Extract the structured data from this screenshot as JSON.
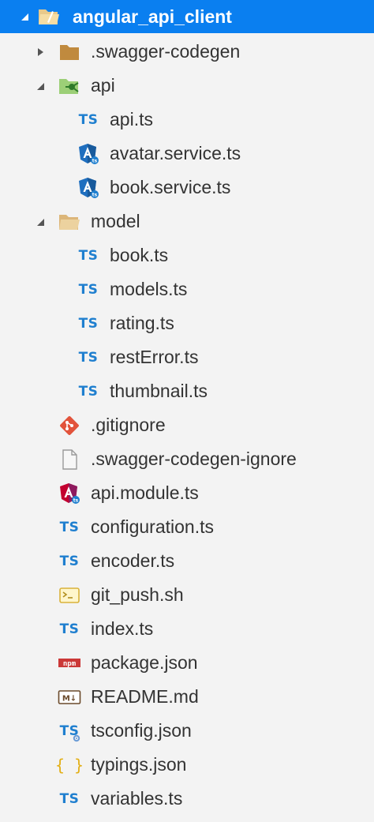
{
  "explorer": {
    "root": {
      "label": "angular_api_client",
      "icon": "folder-open-icon",
      "expanded": true
    },
    "items": [
      {
        "label": ".swagger-codegen",
        "icon": "folder-icon",
        "expanded": false
      },
      {
        "label": "api",
        "icon": "api-folder-icon",
        "expanded": true
      },
      {
        "label": "api.ts",
        "icon": "typescript-icon",
        "icon_text": "TS"
      },
      {
        "label": "avatar.service.ts",
        "icon": "angular-service-icon"
      },
      {
        "label": "book.service.ts",
        "icon": "angular-service-icon"
      },
      {
        "label": "model",
        "icon": "folder-open-icon",
        "expanded": true
      },
      {
        "label": "book.ts",
        "icon": "typescript-icon",
        "icon_text": "TS"
      },
      {
        "label": "models.ts",
        "icon": "typescript-icon",
        "icon_text": "TS"
      },
      {
        "label": "rating.ts",
        "icon": "typescript-icon",
        "icon_text": "TS"
      },
      {
        "label": "restError.ts",
        "icon": "typescript-icon",
        "icon_text": "TS"
      },
      {
        "label": "thumbnail.ts",
        "icon": "typescript-icon",
        "icon_text": "TS"
      },
      {
        "label": ".gitignore",
        "icon": "git-icon"
      },
      {
        "label": ".swagger-codegen-ignore",
        "icon": "file-icon"
      },
      {
        "label": "api.module.ts",
        "icon": "angular-module-icon"
      },
      {
        "label": "configuration.ts",
        "icon": "typescript-icon",
        "icon_text": "TS"
      },
      {
        "label": "encoder.ts",
        "icon": "typescript-icon",
        "icon_text": "TS"
      },
      {
        "label": "git_push.sh",
        "icon": "shell-icon"
      },
      {
        "label": "index.ts",
        "icon": "typescript-icon",
        "icon_text": "TS"
      },
      {
        "label": "package.json",
        "icon": "npm-icon",
        "icon_text": "npm"
      },
      {
        "label": "README.md",
        "icon": "markdown-icon",
        "icon_text": "M↓"
      },
      {
        "label": "tsconfig.json",
        "icon": "tsconfig-icon",
        "icon_text": "TS"
      },
      {
        "label": "typings.json",
        "icon": "json-icon",
        "icon_text": "{ }"
      },
      {
        "label": "variables.ts",
        "icon": "typescript-icon",
        "icon_text": "TS"
      }
    ]
  },
  "colors": {
    "selection": "#0a7ff0",
    "background": "#f3f3f3",
    "typescript": "#1f7fcf",
    "folder": "#c08a3e",
    "git": "#e2533b",
    "angular": "#c3002f"
  }
}
